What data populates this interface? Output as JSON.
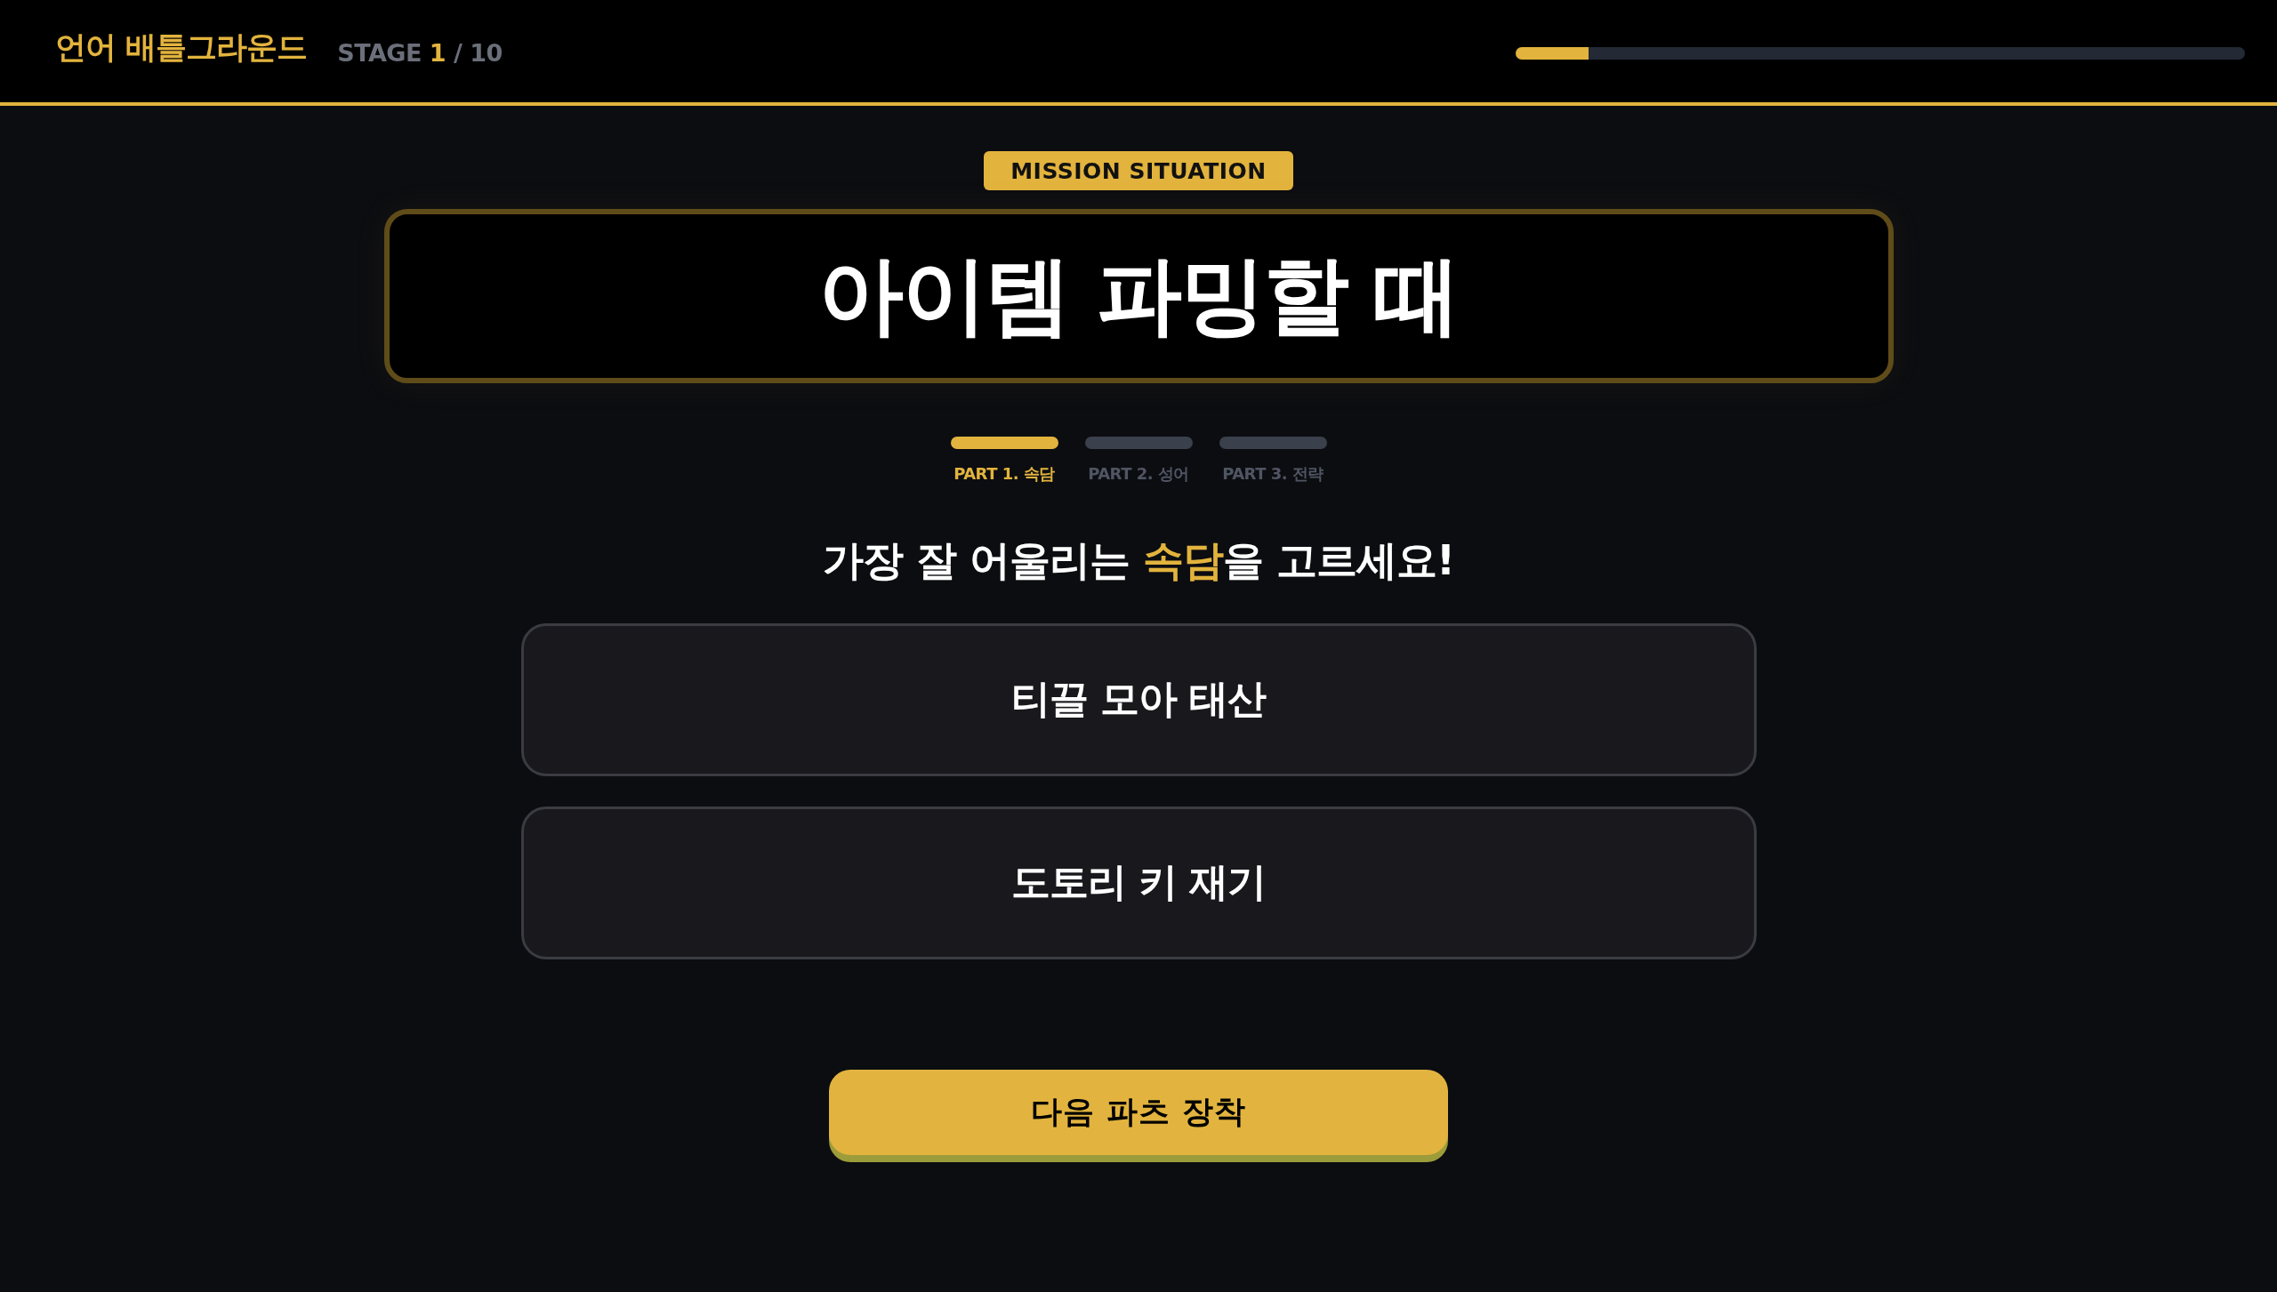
{
  "header": {
    "logo": "언어 배틀그라운드",
    "stage": "STAGE **1** / 10",
    "progress": {
      "level": 0.1
    }
  },
  "mission": {
    "badge": "MISSION SITUATION",
    "title": "아이템 파밍할 때"
  },
  "parts": [
    {
      "label": "PART 1. 속담",
      "selected": true
    },
    {
      "label": "PART 2. 성어",
      "selected": false
    },
    {
      "label": "PART 3. 전략",
      "selected": false
    }
  ],
  "question": "가장 잘 어울리는 **속담**을 고르세요!",
  "options": [
    {
      "text": "티끌 모아 태산",
      "selected": false
    },
    {
      "text": "도토리 키 재기",
      "selected": false
    }
  ],
  "next_button": "다음 파츠 장착"
}
